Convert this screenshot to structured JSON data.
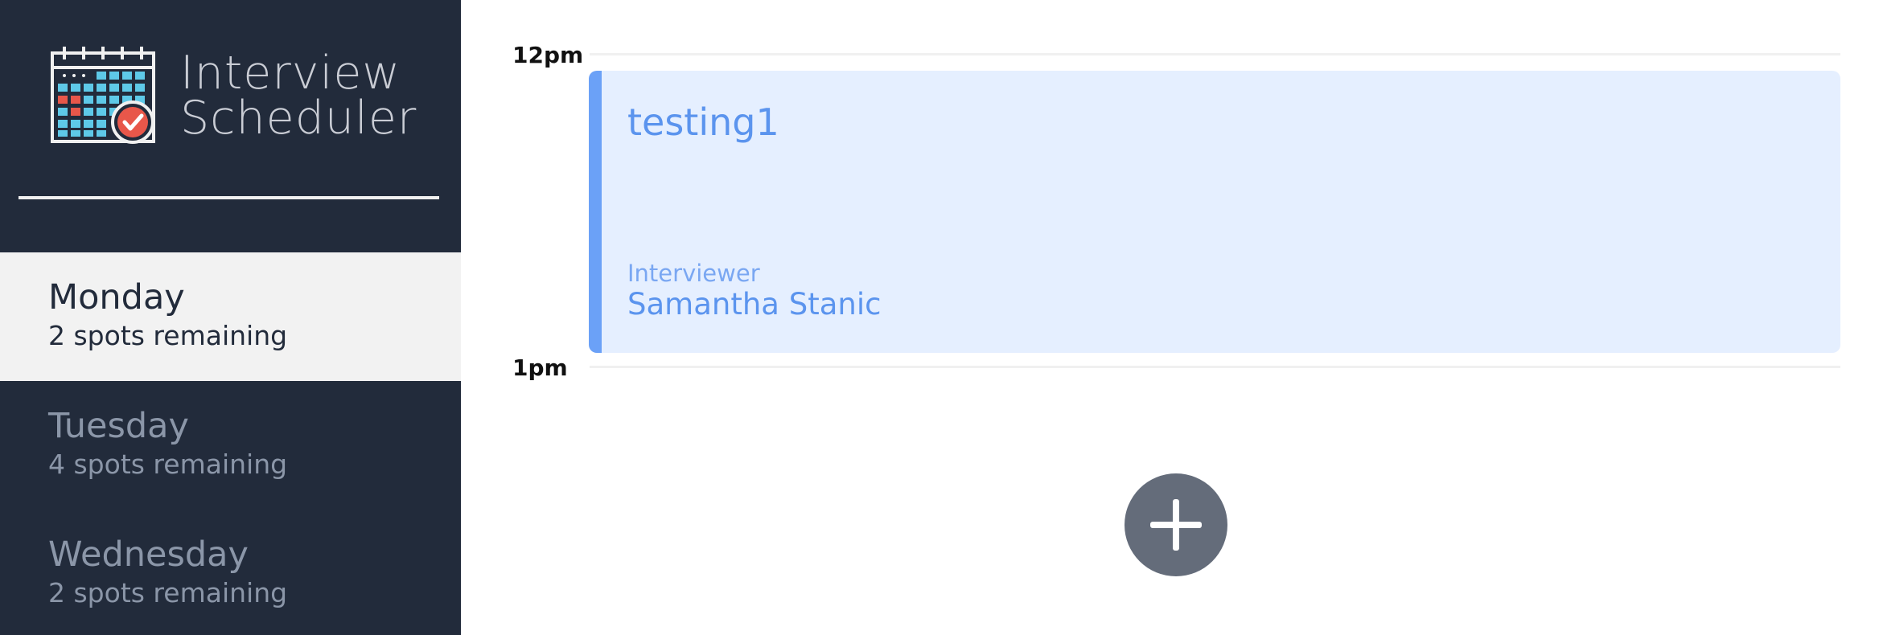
{
  "brand": {
    "line1": "Interview",
    "line2": "Scheduler",
    "logo_icon": "calendar-check-icon"
  },
  "days": [
    {
      "name": "Monday",
      "spots": "2 spots remaining",
      "selected": true
    },
    {
      "name": "Tuesday",
      "spots": "4 spots remaining",
      "selected": false
    },
    {
      "name": "Wednesday",
      "spots": "2 spots remaining",
      "selected": false
    }
  ],
  "schedule": {
    "times": [
      "12pm",
      "1pm"
    ],
    "appointment": {
      "student": "testing1",
      "interviewer_label": "Interviewer",
      "interviewer_name": "Samantha Stanic"
    },
    "add_icon": "plus-icon"
  },
  "colors": {
    "sidebar_bg": "#222b3b",
    "selected_bg": "#f2f2f2",
    "appointment_bg": "#e5efff",
    "appointment_accent": "#6ba1f7",
    "add_button_bg": "#646c7a"
  }
}
